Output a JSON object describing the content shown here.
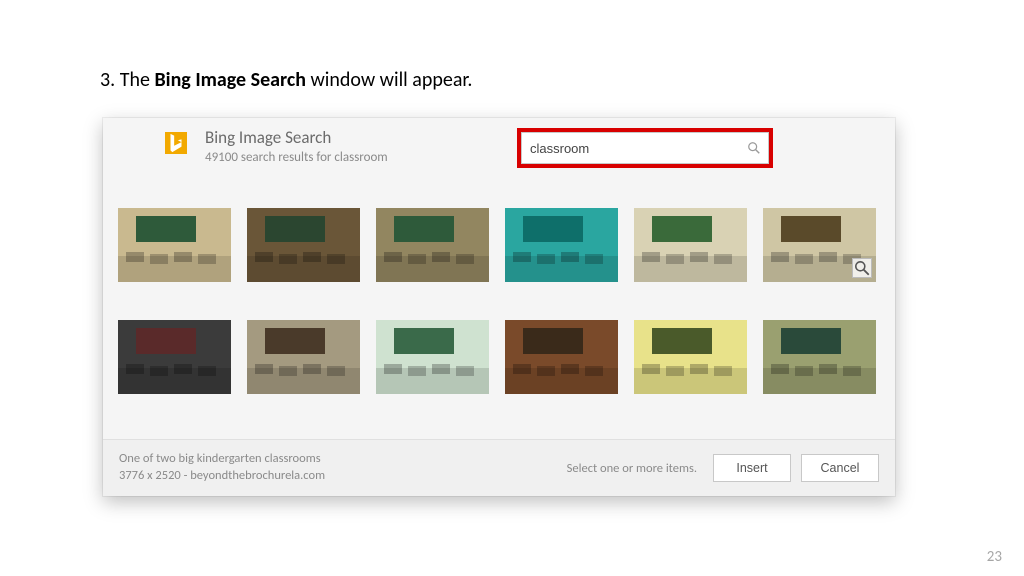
{
  "page": {
    "step_number": "3.",
    "step_prefix": "The ",
    "step_bold": "Bing Image Search",
    "step_suffix": " window will appear.",
    "page_number": "23"
  },
  "header": {
    "title": "Bing Image Search",
    "subtitle": "49100 search results for classroom"
  },
  "search": {
    "value": "classroom"
  },
  "footer": {
    "info_line1": "One of two big kindergarten classrooms",
    "info_line2": "3776 x 2520 - beyondthebrochurela.com",
    "hint": "Select one or more items.",
    "insert_label": "Insert",
    "cancel_label": "Cancel"
  },
  "thumbs": {
    "row1": [
      {
        "bg": "#c9b98f",
        "board": "#2e5a3a"
      },
      {
        "bg": "#6a5638",
        "board": "#2b4630"
      },
      {
        "bg": "#928660",
        "board": "#2e5a3a"
      },
      {
        "bg": "#2aa6a0",
        "board": "#0e6f6a"
      },
      {
        "bg": "#d9d2b4",
        "board": "#3a6a3a"
      },
      {
        "bg": "#cfc6a4",
        "board": "#5a4a2a"
      }
    ],
    "row2": [
      {
        "bg": "#3b3b3b",
        "board": "#5a2a2a"
      },
      {
        "bg": "#a49a80",
        "board": "#4a3a2a"
      },
      {
        "bg": "#cfe2d0",
        "board": "#3a6a4a"
      },
      {
        "bg": "#7a4a2a",
        "board": "#3a2a1a"
      },
      {
        "bg": "#e8e28a",
        "board": "#4a5a2a"
      },
      {
        "bg": "#9aa070",
        "board": "#2a4a3a"
      }
    ]
  }
}
